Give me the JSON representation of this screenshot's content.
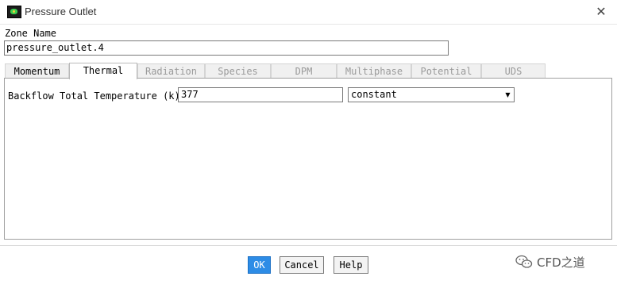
{
  "window": {
    "title": "Pressure Outlet",
    "close_glyph": "✕"
  },
  "zone": {
    "label": "Zone Name",
    "value": "pressure_outlet.4"
  },
  "tabs": [
    {
      "label": "Momentum",
      "enabled": true,
      "active": false
    },
    {
      "label": "Thermal",
      "enabled": true,
      "active": true
    },
    {
      "label": "Radiation",
      "enabled": false,
      "active": false
    },
    {
      "label": "Species",
      "enabled": false,
      "active": false
    },
    {
      "label": "DPM",
      "enabled": false,
      "active": false
    },
    {
      "label": "Multiphase",
      "enabled": false,
      "active": false
    },
    {
      "label": "Potential",
      "enabled": false,
      "active": false
    },
    {
      "label": "UDS",
      "enabled": false,
      "active": false
    }
  ],
  "thermal": {
    "backflow_label": "Backflow Total Temperature (k)",
    "backflow_value": "377",
    "method_value": "constant",
    "dropdown_arrow": "▼"
  },
  "buttons": {
    "ok": "OK",
    "cancel": "Cancel",
    "help": "Help"
  },
  "watermark": {
    "text": "CFD之道",
    "icon": "wechat-icon"
  },
  "colors": {
    "ok_button": "#2d8ce6",
    "icon_green": "#3ccf4e"
  }
}
